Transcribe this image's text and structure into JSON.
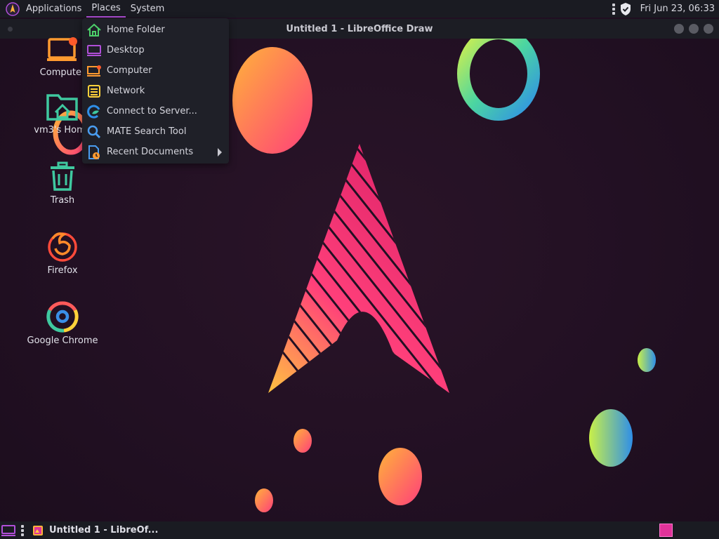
{
  "top_panel": {
    "menus": [
      "Applications",
      "Places",
      "System"
    ],
    "clock": "Fri Jun 23, 06:33"
  },
  "window": {
    "title": "Untitled 1 - LibreOffice Draw"
  },
  "places_menu": {
    "items": [
      {
        "label": "Home Folder",
        "icon": "home-icon"
      },
      {
        "label": "Desktop",
        "icon": "desktop-icon"
      },
      {
        "label": "Computer",
        "icon": "computer-icon"
      },
      {
        "label": "Network",
        "icon": "network-icon"
      },
      {
        "label": "Connect to Server...",
        "icon": "server-icon"
      },
      {
        "label": "MATE Search Tool",
        "icon": "search-icon"
      },
      {
        "label": "Recent Documents",
        "icon": "recent-documents-icon"
      }
    ]
  },
  "desktop_icons": [
    {
      "label": "Computer",
      "icon": "computer-icon"
    },
    {
      "label": "vm3's Home",
      "icon": "home-folder-icon"
    },
    {
      "label": "Trash",
      "icon": "trash-icon"
    },
    {
      "label": "Firefox",
      "icon": "firefox-icon"
    },
    {
      "label": "Google Chrome",
      "icon": "chrome-icon"
    }
  ],
  "taskbar": {
    "tasks": [
      {
        "label": "Untitled 1 - LibreOf..."
      }
    ]
  },
  "colors": {
    "accent": "#b04fd8",
    "panel": "#1a1b22",
    "background": "#221023"
  }
}
